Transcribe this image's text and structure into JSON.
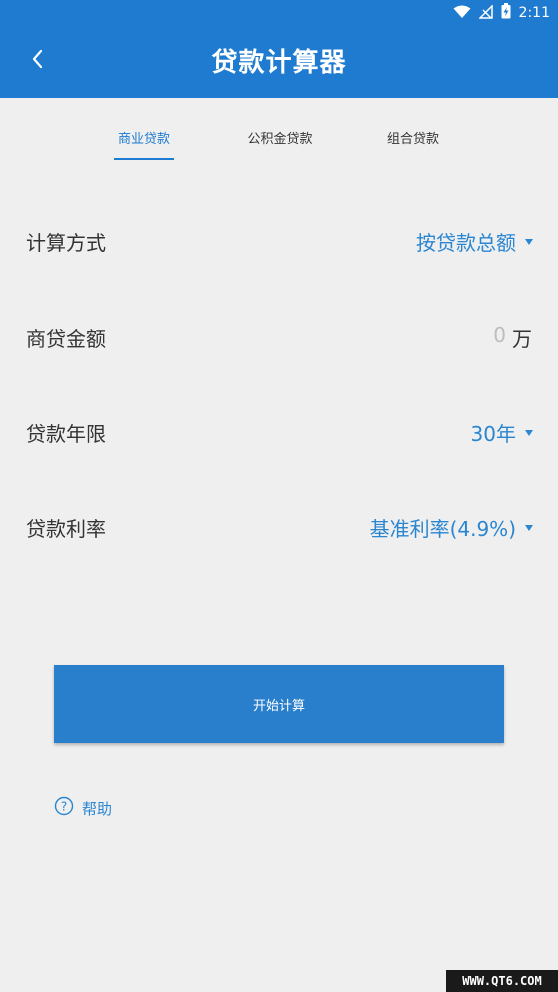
{
  "status_bar": {
    "time": "2:11",
    "icons": [
      "wifi-icon",
      "no-signal-icon",
      "battery-charging-icon"
    ]
  },
  "header": {
    "title": "贷款计算器",
    "back_icon": "chevron-left-icon"
  },
  "tabs": [
    {
      "label": "商业贷款",
      "active": true
    },
    {
      "label": "公积金贷款",
      "active": false
    },
    {
      "label": "组合贷款",
      "active": false
    }
  ],
  "form": {
    "method": {
      "label": "计算方式",
      "value": "按贷款总额"
    },
    "amount": {
      "label": "商贷金额",
      "placeholder": "0",
      "unit": "万"
    },
    "term": {
      "label": "贷款年限",
      "value": "30年"
    },
    "rate": {
      "label": "贷款利率",
      "value": "基准利率(4.9%)"
    }
  },
  "actions": {
    "calculate_label": "开始计算",
    "help_label": "帮助",
    "help_icon": "question-circle-icon"
  },
  "watermark": "WWW.QT6.COM",
  "colors": {
    "primary": "#1e7bd0",
    "accent_text": "#2a86d1",
    "background": "#efefef"
  }
}
